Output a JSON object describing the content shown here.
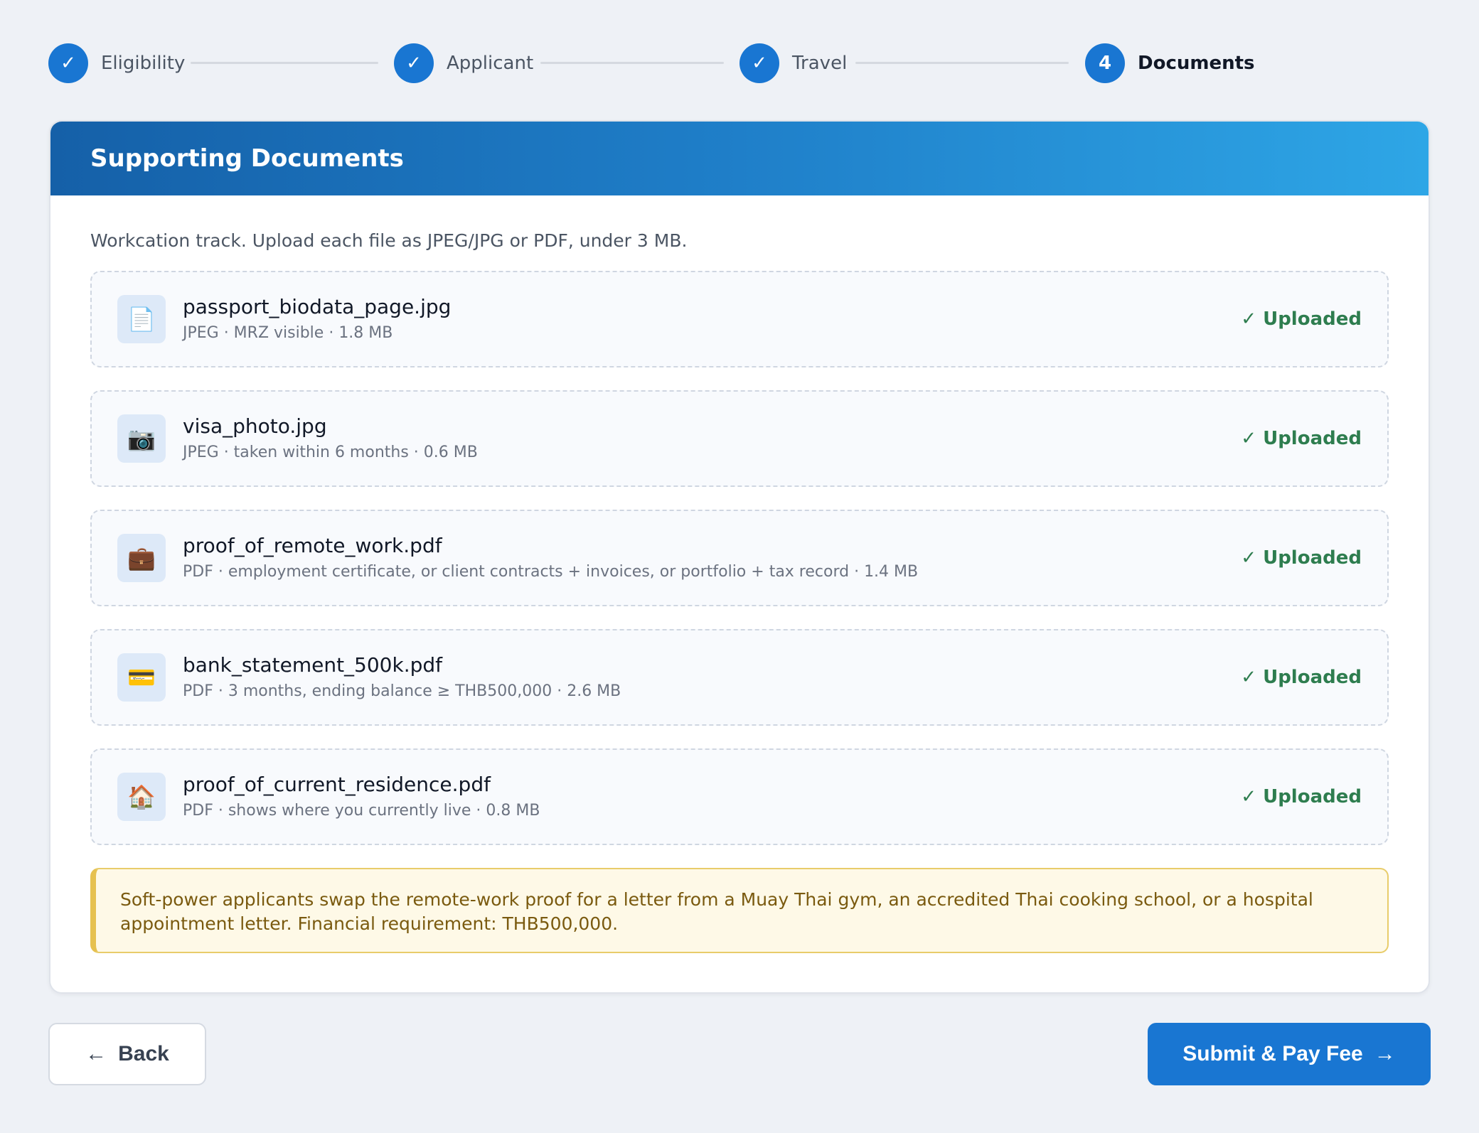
{
  "stepper": {
    "steps": [
      {
        "label": "Eligibility",
        "marker": "✓",
        "state": "complete"
      },
      {
        "label": "Applicant",
        "marker": "✓",
        "state": "complete"
      },
      {
        "label": "Travel",
        "marker": "✓",
        "state": "complete"
      },
      {
        "label": "Documents",
        "marker": "4",
        "state": "active"
      }
    ]
  },
  "card": {
    "title": "Supporting Documents",
    "intro": "Workcation track. Upload each file as JPEG/JPG or PDF, under 3 MB.",
    "documents": [
      {
        "icon": "document-icon",
        "glyph": "📄",
        "name": "passport_biodata_page.jpg",
        "meta": "JPEG · MRZ visible · 1.8 MB",
        "status": "✓ Uploaded"
      },
      {
        "icon": "camera-icon",
        "glyph": "📷",
        "name": "visa_photo.jpg",
        "meta": "JPEG · taken within 6 months · 0.6 MB",
        "status": "✓ Uploaded"
      },
      {
        "icon": "briefcase-icon",
        "glyph": "💼",
        "name": "proof_of_remote_work.pdf",
        "meta": "PDF · employment certificate, or client contracts + invoices, or portfolio + tax record · 1.4 MB",
        "status": "✓ Uploaded"
      },
      {
        "icon": "credit-card-icon",
        "glyph": "💳",
        "name": "bank_statement_500k.pdf",
        "meta": "PDF · 3 months, ending balance ≥ THB500,000 · 2.6 MB",
        "status": "✓ Uploaded"
      },
      {
        "icon": "house-icon",
        "glyph": "🏠",
        "name": "proof_of_current_residence.pdf",
        "meta": "PDF · shows where you currently live · 0.8 MB",
        "status": "✓ Uploaded"
      }
    ],
    "notice": "Soft-power applicants swap the remote-work proof for a letter from a Muay Thai gym, an accredited Thai cooking school, or a hospital appointment letter. Financial requirement: THB500,000."
  },
  "footer": {
    "back_label": "Back",
    "back_arrow": "←",
    "submit_label": "Submit & Pay Fee",
    "submit_arrow": "→"
  },
  "colors": {
    "accent": "#1976d2",
    "success": "#2e7d4f",
    "notice_bg": "#fef9e7",
    "notice_border": "#e6c150",
    "header_gradient_start": "#1560a8",
    "header_gradient_end": "#2ea6e6"
  }
}
